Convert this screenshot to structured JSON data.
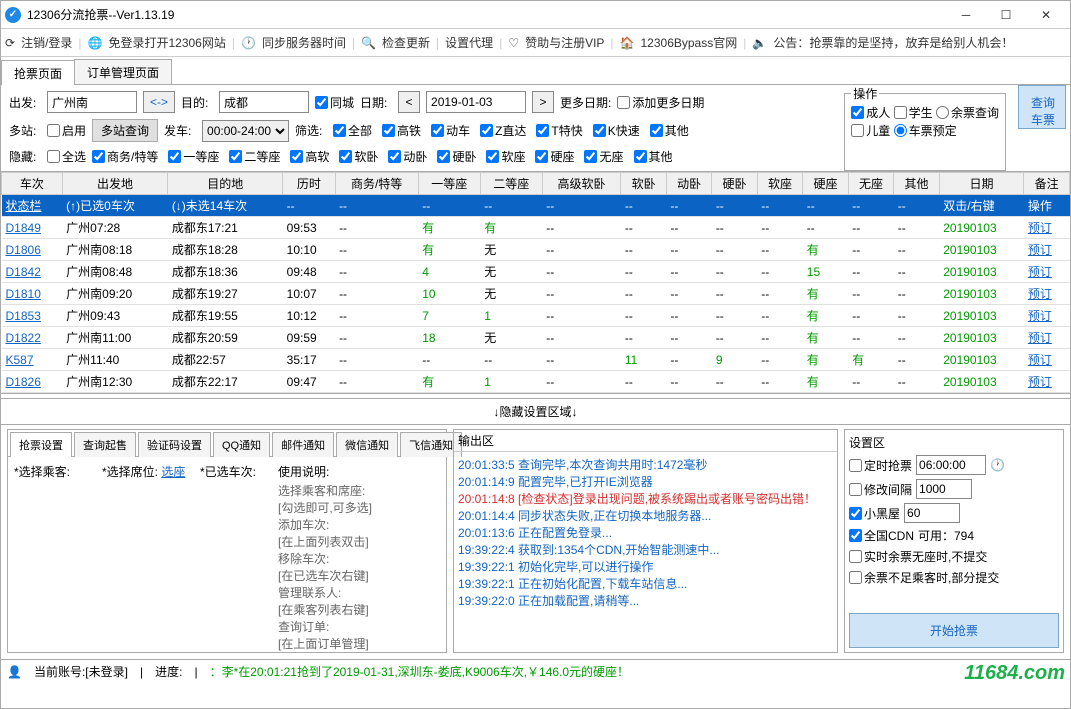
{
  "window": {
    "title": "12306分流抢票--Ver1.13.19"
  },
  "toolbar": {
    "logout": "注销/登录",
    "nologin": "免登录打开12306网站",
    "sync": "同步服务器时间",
    "update": "检查更新",
    "proxy": "设置代理",
    "vip": "赞助与注册VIP",
    "bypass": "12306Bypass官网",
    "notice": "公告：抢票靠的是坚持，放弃是给别人机会！"
  },
  "main_tabs": {
    "grab": "抢票页面",
    "orders": "订单管理页面"
  },
  "search": {
    "from_lbl": "出发:",
    "from_val": "广州南",
    "to_lbl": "目的:",
    "to_val": "成都",
    "same_city": "同城",
    "date_lbl": "日期:",
    "date_val": "2019-01-03",
    "more_date_lbl": "更多日期:",
    "more_date_add": "添加更多日期",
    "multi_lbl": "多站:",
    "enable": "启用",
    "multi_query": "多站查询",
    "depart_lbl": "发车:",
    "time_val": "00:00-24:00",
    "filter_lbl": "筛选:",
    "filters": [
      "全部",
      "高铁",
      "动车",
      "Z直达",
      "T特快",
      "K快速",
      "其他"
    ],
    "hide_lbl": "隐藏:",
    "hide_all": "全选",
    "hides": [
      "商务/特等",
      "一等座",
      "二等座",
      "高软",
      "软卧",
      "动卧",
      "硬卧",
      "软座",
      "硬座",
      "无座",
      "其他"
    ],
    "ops_legend": "操作",
    "adult": "成人",
    "student": "学生",
    "child": "儿童",
    "remain_query": "余票查询",
    "reserve": "车票预定",
    "query_btn": "查询\n车票"
  },
  "table": {
    "cols": [
      "车次",
      "出发地",
      "目的地",
      "历时",
      "商务/特等",
      "一等座",
      "二等座",
      "高级软卧",
      "软卧",
      "动卧",
      "硬卧",
      "软座",
      "硬座",
      "无座",
      "其他",
      "日期",
      "备注"
    ],
    "status_row": {
      "c0": "状态栏",
      "c1": "(↑)已选0车次",
      "c2": "(↓)未选14车次",
      "c15": "双击/右键",
      "c16": "操作"
    },
    "rows": [
      {
        "train": "D1849",
        "dep": "广州07:28",
        "arr": "成都东17:21",
        "dur": "09:53",
        "bus": "--",
        "s1": "有",
        "s2": "有",
        "gr": "--",
        "rw": "--",
        "dw": "--",
        "yw": "--",
        "rz": "--",
        "yz": "--",
        "wz": "--",
        "qt": "--",
        "date": "20190103",
        "note": "预订"
      },
      {
        "train": "D1806",
        "dep": "广州南08:18",
        "arr": "成都东18:28",
        "dur": "10:10",
        "bus": "--",
        "s1": "有",
        "s2": "无",
        "gr": "--",
        "rw": "--",
        "dw": "--",
        "yw": "--",
        "rz": "--",
        "yz": "有",
        "wz": "--",
        "qt": "--",
        "date": "20190103",
        "note": "预订"
      },
      {
        "train": "D1842",
        "dep": "广州南08:48",
        "arr": "成都东18:36",
        "dur": "09:48",
        "bus": "--",
        "s1": "4",
        "s2": "无",
        "gr": "--",
        "rw": "--",
        "dw": "--",
        "yw": "--",
        "rz": "--",
        "yz": "15",
        "wz": "--",
        "qt": "--",
        "date": "20190103",
        "note": "预订"
      },
      {
        "train": "D1810",
        "dep": "广州南09:20",
        "arr": "成都东19:27",
        "dur": "10:07",
        "bus": "--",
        "s1": "10",
        "s2": "无",
        "gr": "--",
        "rw": "--",
        "dw": "--",
        "yw": "--",
        "rz": "--",
        "yz": "有",
        "wz": "--",
        "qt": "--",
        "date": "20190103",
        "note": "预订"
      },
      {
        "train": "D1853",
        "dep": "广州09:43",
        "arr": "成都东19:55",
        "dur": "10:12",
        "bus": "--",
        "s1": "7",
        "s2": "1",
        "gr": "--",
        "rw": "--",
        "dw": "--",
        "yw": "--",
        "rz": "--",
        "yz": "有",
        "wz": "--",
        "qt": "--",
        "date": "20190103",
        "note": "预订"
      },
      {
        "train": "D1822",
        "dep": "广州南11:00",
        "arr": "成都东20:59",
        "dur": "09:59",
        "bus": "--",
        "s1": "18",
        "s2": "无",
        "gr": "--",
        "rw": "--",
        "dw": "--",
        "yw": "--",
        "rz": "--",
        "yz": "有",
        "wz": "--",
        "qt": "--",
        "date": "20190103",
        "note": "预订"
      },
      {
        "train": "K587",
        "dep": "广州11:40",
        "arr": "成都22:57",
        "dur": "35:17",
        "bus": "--",
        "s1": "--",
        "s2": "--",
        "gr": "--",
        "rw": "11",
        "dw": "--",
        "yw": "9",
        "rz": "--",
        "yz": "有",
        "wz": "有",
        "qt": "--",
        "date": "20190103",
        "note": "预订"
      },
      {
        "train": "D1826",
        "dep": "广州南12:30",
        "arr": "成都东22:17",
        "dur": "09:47",
        "bus": "--",
        "s1": "有",
        "s2": "1",
        "gr": "--",
        "rw": "--",
        "dw": "--",
        "yw": "--",
        "rz": "--",
        "yz": "有",
        "wz": "--",
        "qt": "--",
        "date": "20190103",
        "note": "预订"
      }
    ]
  },
  "hide_area": "↓隐藏设置区域↓",
  "left_tabs": [
    "抢票设置",
    "查询起售",
    "验证码设置",
    "QQ通知",
    "邮件通知",
    "微信通知",
    "飞信通知"
  ],
  "left_panel": {
    "passenger_hdr": "*选择乘客:",
    "seat_hdr": "*选择席位:",
    "seat_link": "选座",
    "train_hdr": "*已选车次:",
    "usage_hdr": "使用说明:",
    "usage": [
      "选择乘客和席座:",
      "[勾选即可,可多选]",
      "添加车次:",
      "[在上面列表双击]",
      "移除车次:",
      "[在已选车次右键]",
      "管理联系人:",
      "[在乘客列表右键]",
      "查询订单:",
      "[在上面订单管理]"
    ]
  },
  "output": {
    "hdr": "输出区",
    "lines": [
      {
        "t": "20:01:33:5",
        "m": "查询完毕,本次查询共用时:1472毫秒"
      },
      {
        "t": "20:01:14:9",
        "m": "配置完毕,已打开IE浏览器"
      },
      {
        "t": "20:01:14:8",
        "m": "[检查状态]登录出现问题,被系统踢出或者账号密码出错！",
        "err": true
      },
      {
        "t": "20:01:14:4",
        "m": "同步状态失败,正在切换本地服务器..."
      },
      {
        "t": "20:01:13:6",
        "m": "正在配置免登录..."
      },
      {
        "t": "19:39:22:4",
        "m": "获取到:1354个CDN,开始智能测速中..."
      },
      {
        "t": "19:39:22:1",
        "m": "初始化完毕,可以进行操作"
      },
      {
        "t": "19:39:22:1",
        "m": "正在初始化配置,下载车站信息..."
      },
      {
        "t": "19:39:22:0",
        "m": "正在加载配置,请稍等..."
      }
    ]
  },
  "settings": {
    "hdr": "设置区",
    "timed": "定时抢票",
    "timed_val": "06:00:00",
    "interval": "修改间隔",
    "interval_val": "1000",
    "blackroom": "小黑屋",
    "blackroom_val": "60",
    "cdn": "全国CDN",
    "cdn_info": "可用：794",
    "realtime": "实时余票无座时,不提交",
    "notenough": "余票不足乘客时,部分提交",
    "start": "开始抢票"
  },
  "status": {
    "account_lbl": "当前账号:[未登录]",
    "progress_lbl": "进度:",
    "msg": "：李*在20:01:21抢到了2019-01-31,深圳东-娄底,K9006车次,￥146.0元的硬座！"
  },
  "watermark": "11684.com"
}
